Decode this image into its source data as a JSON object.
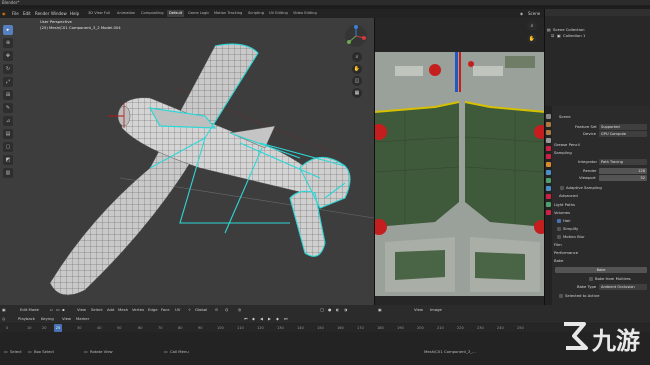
{
  "window": {
    "title": "Blender*"
  },
  "menu": [
    "File",
    "Edit",
    "Render",
    "Window",
    "Help"
  ],
  "workspace_tabs": [
    "3D View Full",
    "Animation",
    "Compositing",
    "Default",
    "Game Logic",
    "Motion Tracking",
    "Scripting",
    "UV Editing",
    "Video Editing"
  ],
  "active_tab_index": 3,
  "top_right": {
    "scene_label": "Scene",
    "layer_label": "RenderLayer"
  },
  "viewport": {
    "view_label": "User Perspective",
    "object_label": "(25) Mesh\\C01 Component_3_2 Model.004"
  },
  "outliner": {
    "title": "Scene Collection",
    "items": [
      "Collection 1"
    ]
  },
  "properties": {
    "scene": "Scene",
    "feature_set_label": "Feature Set",
    "feature_set_value": "Supported",
    "device_label": "Device",
    "device_value": "GPU Compute",
    "sections": [
      "Grease Pencil",
      "Sampling"
    ],
    "integrator_label": "Integrator",
    "integrator_value": "Path Tracing",
    "render_label": "Render",
    "render_value": "128",
    "viewport_label": "Viewport",
    "viewport_value": "32",
    "adaptive_sampling": "Adaptive Sampling",
    "advanced": "Advanced",
    "light_paths": "Light Paths",
    "volumes": "Volumes",
    "hair": "Hair",
    "simplify": "Simplify",
    "motion_blur": "Motion Blur",
    "film": "Film",
    "performance": "Performance",
    "bake": "Bake",
    "bake_button": "Bake",
    "bake_from_multires": "Bake from Multires",
    "bake_type_label": "Bake Type",
    "bake_type_value": "Ambient Occlusion",
    "selected_to_active": "Selected to Active"
  },
  "editor_header": {
    "mode": "Edit Mode",
    "items": [
      "View",
      "Select",
      "Add",
      "Mesh",
      "Vertex",
      "Edge",
      "Face",
      "UV"
    ],
    "orientation": "Global",
    "uv_items": [
      "View",
      "Image"
    ]
  },
  "timeline": {
    "playback": "Playback",
    "keying": "Keying",
    "view": "View",
    "marker": "Marker",
    "current_frame": "25",
    "ticks": [
      "0",
      "10",
      "20",
      "30",
      "40",
      "50",
      "60",
      "70",
      "80",
      "90",
      "100",
      "110",
      "120",
      "130",
      "140",
      "150",
      "160",
      "170",
      "180",
      "190",
      "200",
      "210",
      "220",
      "230",
      "240",
      "250"
    ]
  },
  "statusbar": {
    "left": [
      "Select",
      "Box Select",
      "Rotate View",
      "Call Menu"
    ],
    "right": "Mesh\\C01 Component_3_..."
  },
  "watermark": {
    "text": "九游"
  },
  "colors": {
    "accent": "#4772b3",
    "wire": "#2fd6d6",
    "uv_green": "#3e5a3a",
    "uv_red": "#c41e1e"
  }
}
